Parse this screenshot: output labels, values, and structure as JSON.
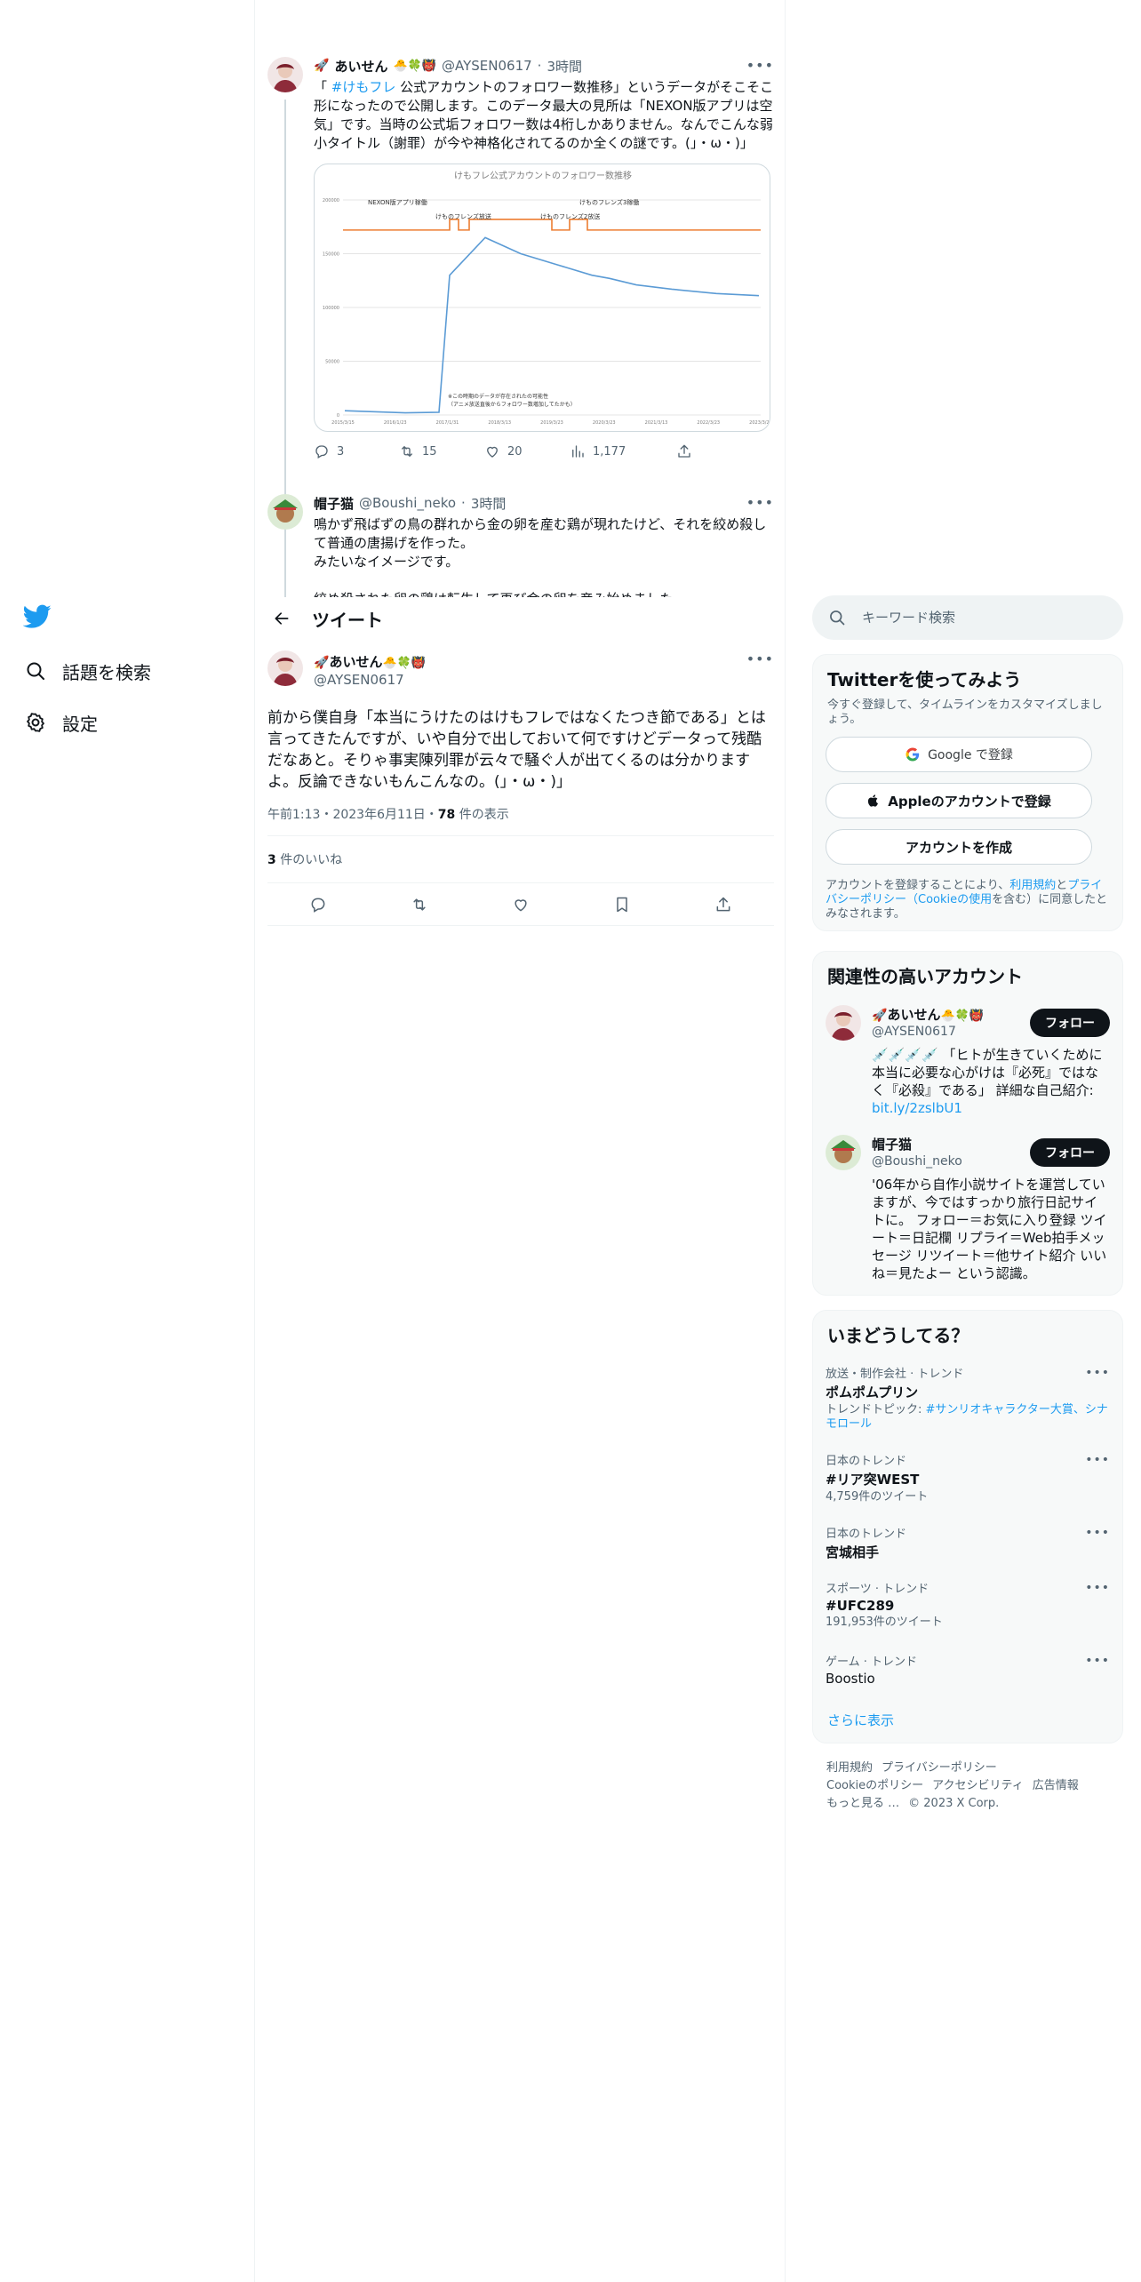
{
  "nav": {
    "logo": "twitter-bird",
    "items": [
      {
        "label": "話題を検索",
        "icon": "search-icon"
      },
      {
        "label": "設定",
        "icon": "gear-icon"
      }
    ]
  },
  "thread": {
    "tweet1": {
      "name": "あいせん",
      "handle": "@AYSEN0617",
      "time": "3時間",
      "text_pre": "「 ",
      "hashtag": "#けもフレ",
      "text_post": " 公式アカウントのフォロワー数推移」というデータがそこそこ形になったので公開します。このデータ最大の見所は「NEXON版アプリは空気」です。当時の公式垢フォロワー数は4桁しかありません。なんでこんな弱小タイトル（謝罪）が今や神格化されてるのか全くの謎です。(」・ω・)」",
      "stats": {
        "replies": "3",
        "retweets": "15",
        "likes": "20",
        "views": "1,177"
      }
    },
    "tweet2": {
      "name": "帽子猫",
      "handle": "@Boushi_neko",
      "time": "3時間",
      "text": "鳴かず飛ばずの鳥の群れから金の卵を産む鶏が現れたけど、それを絞め殺して普通の唐揚げを作った。\nみたいなイメージです。\n\n絞め殺された卵の鶏は転生して再び金の卵を産み始めました。"
    }
  },
  "header": {
    "title": "ツイート"
  },
  "focus": {
    "name": "あいせん",
    "handle": "@AYSEN0617",
    "text": "前から僕自身「本当にうけたのはけもフレではなくたつき節である」とは言ってきたんですが、いや自分で出しておいて何ですけどデータって残酷だなあと。そりゃ事実陳列罪が云々で騒ぐ人が出てくるのは分かりますよ。反論できないもんこんなの。(」・ω・)」",
    "timestamp": "午前1:13・2023年6月11日・",
    "views_count": "78",
    "views_label": " 件の表示",
    "likes_count": "3",
    "likes_label": " 件のいいね"
  },
  "search": {
    "placeholder": "キーワード検索"
  },
  "signup": {
    "title": "Twitterを使ってみよう",
    "subtitle": "今すぐ登録して、タイムラインをカスタマイズしましょう。",
    "google": "Google で登録",
    "apple": "Appleのアカウントで登録",
    "create": "アカウントを作成",
    "legal_1": "アカウントを登録することにより、",
    "terms": "利用規約",
    "legal_2": "と",
    "privacy": "プライバシーポリシー（Cookieの使用",
    "legal_3": "を含む）に同意したとみなされます。"
  },
  "related": {
    "title": "関連性の高いアカウント",
    "accounts": [
      {
        "name": "あいせん",
        "handle": "@AYSEN0617",
        "bio": "💉💉💉💉 「ヒトが生きていくために本当に必要な心がけは『必死』ではなく『必殺』である」 詳細な自己紹介:",
        "link": "bit.ly/2zslbU1",
        "follow": "フォロー"
      },
      {
        "name": "帽子猫",
        "handle": "@Boushi_neko",
        "bio": "'06年から自作小説サイトを運営していますが、今ではすっかり旅行日記サイトに。 フォロー＝お気に入り登録 ツイート＝日記欄 リプライ＝Web拍手メッセージ リツイート＝他サイト紹介 いいね＝見たよー という認識。",
        "follow": "フォロー"
      }
    ]
  },
  "trends": {
    "title": "いまどうしてる？",
    "items": [
      {
        "category": "放送・制作会社 · トレンド",
        "name": "ポムポムプリン",
        "sub_label": "トレンドトピック: ",
        "sub_link": "#サンリオキャラクター大賞、シナモロール"
      },
      {
        "category": "日本のトレンド",
        "name": "#リア突WEST",
        "sub": "4,759件のツイート"
      },
      {
        "category": "日本のトレンド",
        "name": "宮城相手",
        "sub": ""
      },
      {
        "category": "スポーツ · トレンド",
        "name": "#UFC289",
        "sub": "191,953件のツイート"
      },
      {
        "category": "ゲーム · トレンド",
        "name": "Boostio",
        "sub": ""
      }
    ],
    "show_more": "さらに表示"
  },
  "footer": {
    "links": [
      "利用規約",
      "プライバシーポリシー",
      "Cookieのポリシー",
      "アクセシビリティ",
      "広告情報",
      "もっと見る …"
    ],
    "copyright": "© 2023 X Corp."
  },
  "colors": {
    "accent": "#1d9bf0",
    "text": "#0f1419",
    "muted": "#536471",
    "chart_line": "#5b9bd5",
    "chart_orange": "#ed7d31"
  },
  "chart_data": {
    "type": "line",
    "title": "けもフレ公式アカウントのフォロワー数推移",
    "x": [
      "2015/3/15",
      "2016/1/23",
      "2017/1/31",
      "2018/3/13",
      "2019/3/23",
      "2020/3/23",
      "2021/3/13",
      "2022/3/23",
      "2023/3/23"
    ],
    "ytick_labels": [
      "0",
      "50000",
      "100000",
      "150000",
      "200000"
    ],
    "ylim": [
      0,
      200000
    ],
    "series": [
      {
        "values": [
          4000,
          2000,
          2500,
          130000,
          165000,
          150000,
          140000,
          130000,
          127000,
          121000,
          117000,
          113000,
          111000
        ]
      }
    ],
    "annotations": [
      "NEXON版アプリ稼働",
      "けものフレンズ放送",
      "けものフレンズ3稼働",
      "けものフレンズ2放送",
      "※この時期のデータが存在されたの可能性",
      "（アニメ放送直後からフォロワー数増加してたかも）"
    ]
  }
}
